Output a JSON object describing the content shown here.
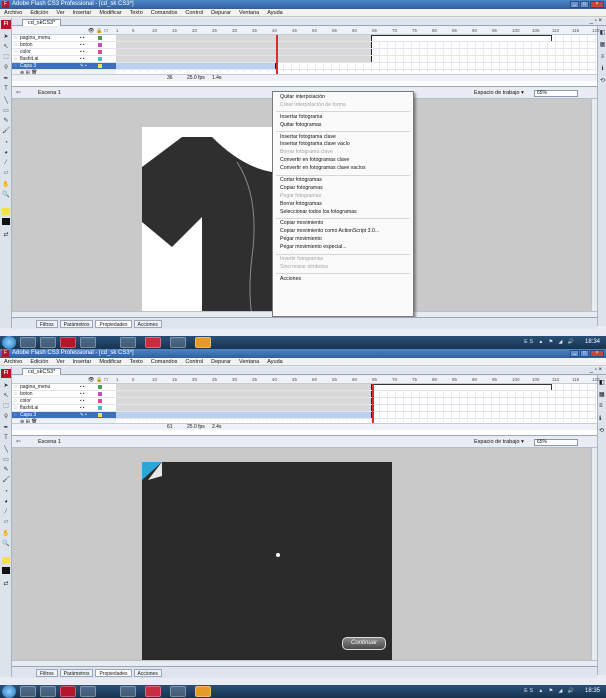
{
  "app": {
    "window_title": "Adobe Flash CS3 Professional - [cd_sk CS3*]",
    "doc_tab": "cd_skCS3*"
  },
  "menu": [
    "Archivo",
    "Edición",
    "Ver",
    "Insertar",
    "Modificar",
    "Texto",
    "Comandos",
    "Control",
    "Depurar",
    "Ventana",
    "Ayuda"
  ],
  "timeline": {
    "layers": [
      "pagina_menu",
      "boton",
      "color",
      "flashit.ai",
      "Capa 3"
    ],
    "ruler": [
      "1",
      "5",
      "10",
      "15",
      "20",
      "25",
      "30",
      "35",
      "40",
      "45",
      "50",
      "55",
      "60",
      "65",
      "70",
      "75",
      "80",
      "85",
      "90",
      "95",
      "100",
      "105",
      "110",
      "115",
      "120"
    ]
  },
  "shot1": {
    "frame_number": "36",
    "fps": "25.0 fps",
    "seconds": "1.4s"
  },
  "shot2": {
    "frame_number": "61",
    "fps": "25.0 fps",
    "seconds": "2.4s",
    "continue_label": "Continuar"
  },
  "scene": {
    "label": "Escena 1",
    "workspace": "Espacio de trabajo ▾",
    "zoom": "65%"
  },
  "context_menu": [
    {
      "label": "Quitar interpolación",
      "enabled": true
    },
    {
      "label": "Crear interpolación de forma",
      "enabled": false
    },
    {
      "sep": true
    },
    {
      "label": "Insertar fotograma",
      "enabled": true
    },
    {
      "label": "Quitar fotogramas",
      "enabled": true
    },
    {
      "sep": true
    },
    {
      "label": "Insertar fotograma clave",
      "enabled": true
    },
    {
      "label": "Insertar fotograma clave vacío",
      "enabled": true
    },
    {
      "label": "Borrar fotograma clave",
      "enabled": false
    },
    {
      "label": "Convertir en fotogramas clave",
      "enabled": true
    },
    {
      "label": "Convertir en fotogramas clave vacíos",
      "enabled": true
    },
    {
      "sep": true
    },
    {
      "label": "Cortar fotogramas",
      "enabled": true
    },
    {
      "label": "Copiar fotogramas",
      "enabled": true
    },
    {
      "label": "Pegar fotogramas",
      "enabled": false
    },
    {
      "label": "Borrar fotogramas",
      "enabled": true
    },
    {
      "label": "Seleccionar todos los fotogramas",
      "enabled": true
    },
    {
      "sep": true
    },
    {
      "label": "Copiar movimiento",
      "enabled": true
    },
    {
      "label": "Copiar movimiento como ActionScript 3.0...",
      "enabled": true
    },
    {
      "label": "Pegar movimiento",
      "enabled": true
    },
    {
      "label": "Pegar movimiento especial...",
      "enabled": true
    },
    {
      "sep": true
    },
    {
      "label": "Invertir fotogramas",
      "enabled": false
    },
    {
      "label": "Sincronizar símbolos",
      "enabled": false
    },
    {
      "sep": true
    },
    {
      "label": "Acciones",
      "enabled": true
    }
  ],
  "bottom_tabs": [
    "Filtros",
    "Parámetros",
    "Propiedades",
    "Acciones"
  ],
  "taskbar": {
    "clock1": "18:34",
    "clock2": "18:35"
  },
  "colors": {
    "stage_dark": "#2b2b2b",
    "selected_layer": "#3d6fbf",
    "playhead": "#e0292c"
  }
}
